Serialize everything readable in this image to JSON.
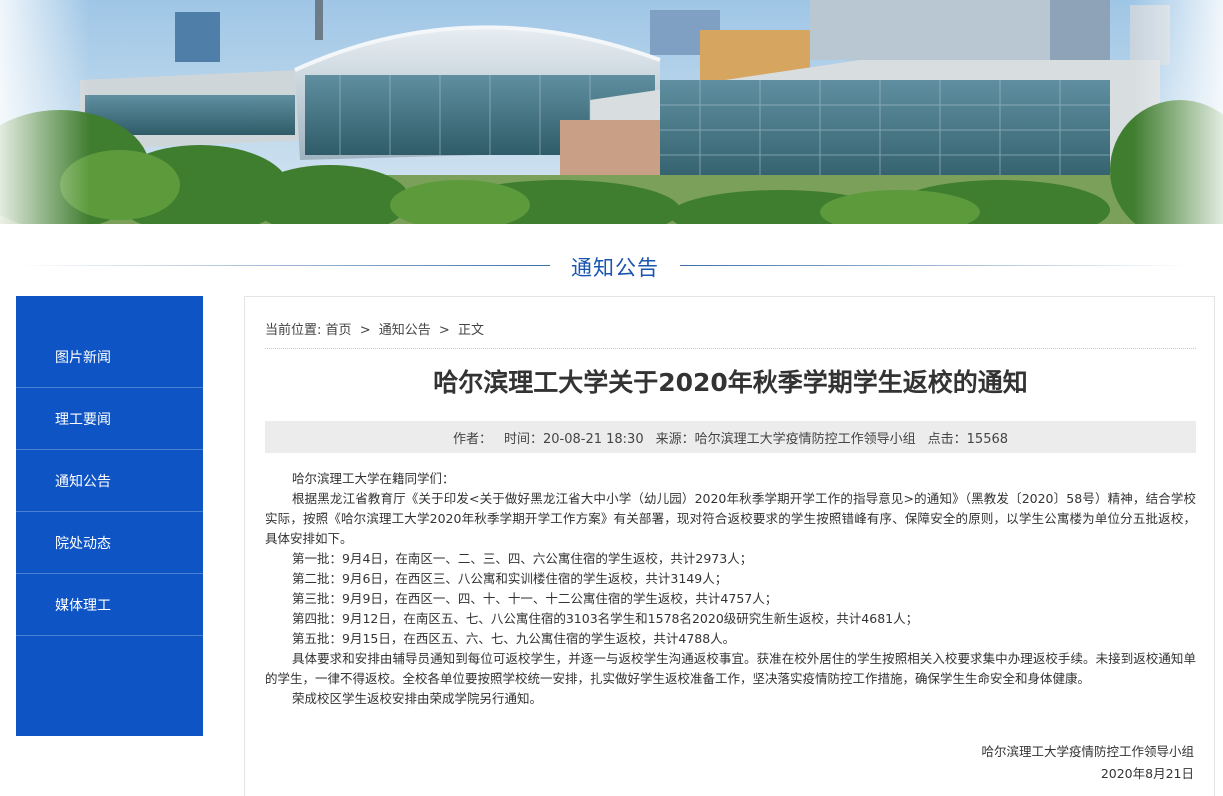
{
  "section": {
    "title": "通知公告"
  },
  "sidebar": {
    "items": [
      {
        "label": "图片新闻"
      },
      {
        "label": "理工要闻"
      },
      {
        "label": "通知公告"
      },
      {
        "label": "院处动态"
      },
      {
        "label": "媒体理工"
      }
    ]
  },
  "breadcrumb": {
    "prefix": "当前位置:",
    "items": [
      "首页",
      "通知公告",
      "正文"
    ],
    "separator": ">"
  },
  "article": {
    "title": "哈尔滨理工大学关于2020年秋季学期学生返校的通知",
    "meta": {
      "author_label": "作者：",
      "author": "",
      "time_label": "时间：",
      "time": "20-08-21 18:30",
      "source_label": "来源：",
      "source": "哈尔滨理工大学疫情防控工作领导小组",
      "clicks_label": "点击：",
      "clicks": "15568"
    },
    "paragraphs": [
      "哈尔滨理工大学在籍同学们：",
      "根据黑龙江省教育厅《关于印发<关于做好黑龙江省大中小学（幼儿园）2020年秋季学期开学工作的指导意见>的通知》（黑教发〔2020〕58号）精神，结合学校实际，按照《哈尔滨理工大学2020年秋季学期开学工作方案》有关部署，现对符合返校要求的学生按照错峰有序、保障安全的原则，以学生公寓楼为单位分五批返校，具体安排如下。",
      "第一批：9月4日，在南区一、二、三、四、六公寓住宿的学生返校，共计2973人；",
      "第二批：9月6日，在西区三、八公寓和实训楼住宿的学生返校，共计3149人；",
      "第三批：9月9日，在西区一、四、十、十一、十二公寓住宿的学生返校，共计4757人；",
      "第四批：9月12日，在南区五、七、八公寓住宿的3103名学生和1578名2020级研究生新生返校，共计4681人；",
      "第五批：9月15日，在西区五、六、七、九公寓住宿的学生返校，共计4788人。",
      "具体要求和安排由辅导员通知到每位可返校学生，并逐一与返校学生沟通返校事宜。获准在校外居住的学生按照相关入校要求集中办理返校手续。未接到返校通知单的学生，一律不得返校。全校各单位要按照学校统一安排，扎实做好学生返校准备工作，坚决落实疫情防控工作措施，确保学生生命安全和身体健康。",
      "荣成校区学生返校安排由荣成学院另行通知。"
    ],
    "signature": {
      "org": "哈尔滨理工大学疫情防控工作领导小组",
      "date": "2020年8月21日"
    }
  },
  "colors": {
    "sidebar_bg": "#0f54c4",
    "section_title": "#1a56b0",
    "meta_bg": "#ececec"
  }
}
